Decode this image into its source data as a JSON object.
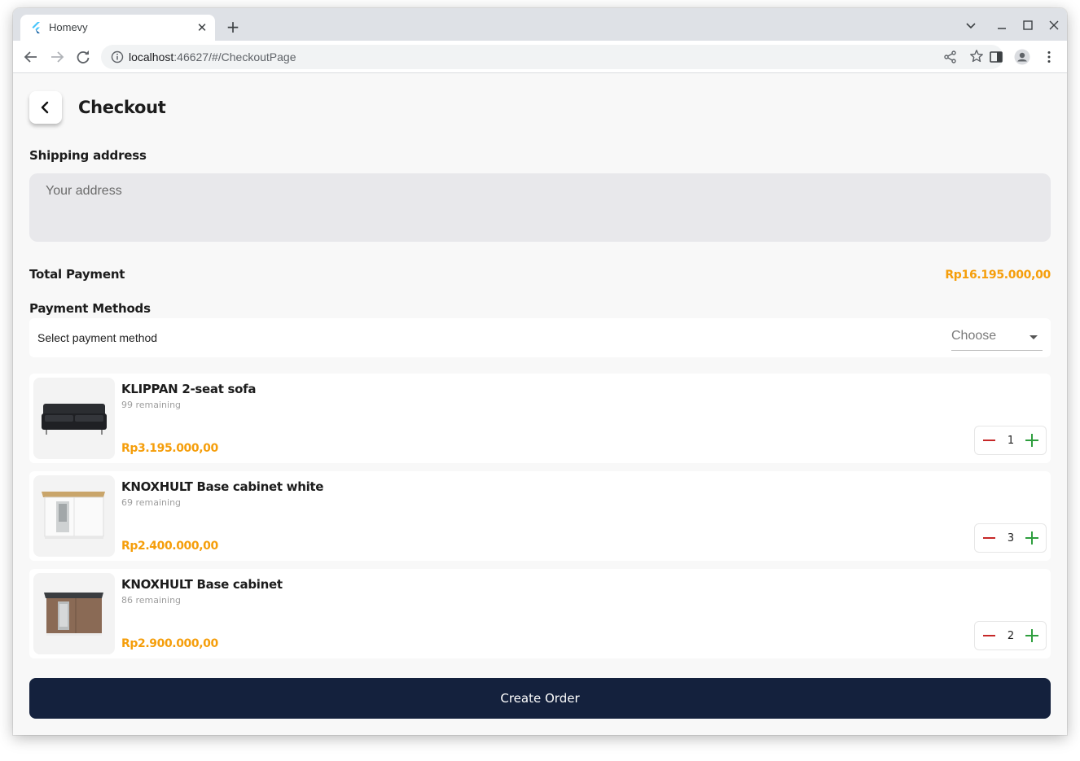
{
  "browser": {
    "tab_title": "Homevy",
    "url_host": "localhost",
    "url_rest": ":46627/#/CheckoutPage",
    "new_tab_symbol": "+",
    "close_symbol": "✕"
  },
  "header": {
    "title": "Checkout"
  },
  "shipping": {
    "label": "Shipping address",
    "placeholder": "Your address",
    "value": ""
  },
  "total": {
    "label": "Total Payment",
    "value": "Rp16.195.000,00"
  },
  "payment": {
    "section_label": "Payment Methods",
    "field_label": "Select payment method",
    "selected": "Choose"
  },
  "items": [
    {
      "name": "KLIPPAN 2-seat sofa",
      "remaining": "99 remaining",
      "price": "Rp3.195.000,00",
      "qty": "1",
      "image": "sofa-image"
    },
    {
      "name": "KNOXHULT Base cabinet white",
      "remaining": "69 remaining",
      "price": "Rp2.400.000,00",
      "qty": "3",
      "image": "white-cabinet-image"
    },
    {
      "name": "KNOXHULT Base cabinet",
      "remaining": "86 remaining",
      "price": "Rp2.900.000,00",
      "qty": "2",
      "image": "wood-cabinet-image"
    }
  ],
  "actions": {
    "create_order": "Create Order"
  },
  "colors": {
    "accent_price": "#f59e0b",
    "primary_button": "#14213d",
    "minus": "#c62828",
    "plus": "#2e9e3e"
  }
}
